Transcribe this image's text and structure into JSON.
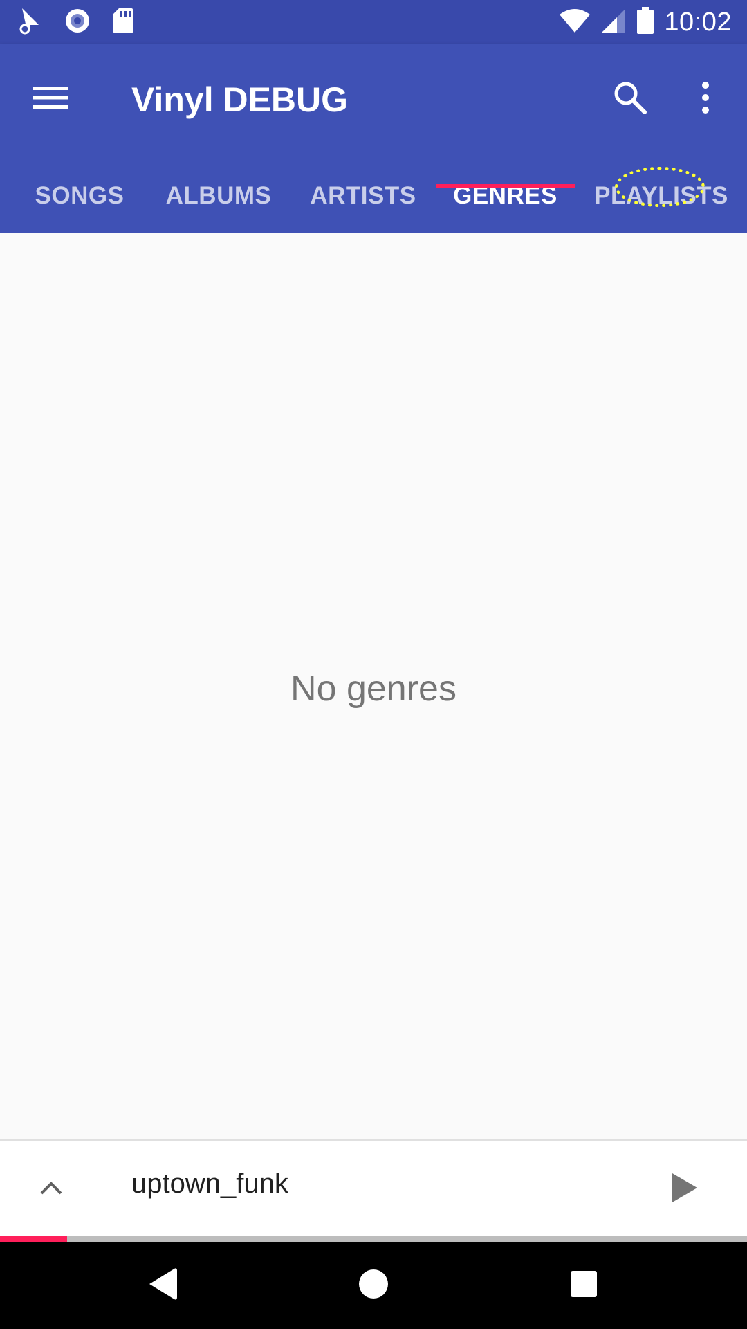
{
  "status_bar": {
    "time": "10:02",
    "left_icons": [
      "notification-icon",
      "record-icon",
      "sd-card-icon"
    ],
    "right_icons": [
      "wifi-icon",
      "signal-icon",
      "battery-icon"
    ]
  },
  "app_bar": {
    "title": "Vinyl DEBUG",
    "menu_icon": "hamburger-menu-icon",
    "search_icon": "search-icon",
    "overflow_icon": "more-vert-icon"
  },
  "tabs": [
    {
      "label": "SONGS"
    },
    {
      "label": "ALBUMS"
    },
    {
      "label": "ARTISTS"
    },
    {
      "label": "GENRES"
    },
    {
      "label": "PLAYLISTS"
    }
  ],
  "selected_tab": "GENRES",
  "content": {
    "empty_message": "No genres"
  },
  "mini_player": {
    "track_title": "uptown_funk",
    "progress_fraction": 0.09
  },
  "colors": {
    "status_bar": "#3949ab",
    "app_bar": "#3f51b5",
    "accent": "#ff1f5a",
    "highlight": "#ffff33"
  }
}
